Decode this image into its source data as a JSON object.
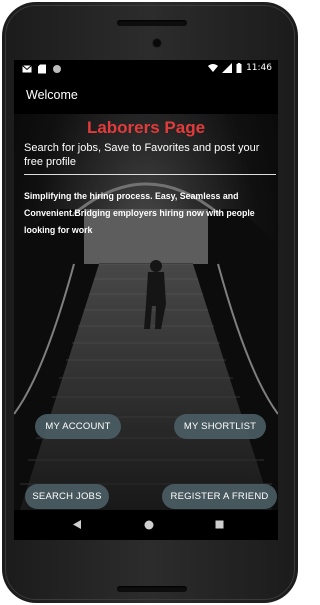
{
  "statusbar": {
    "time": "11:46"
  },
  "appbar": {
    "title": "Welcome"
  },
  "page": {
    "heading": "Laborers Page",
    "subtitle": "Search for jobs, Save to Favorites and post your free profile",
    "description": "Simplifying the hiring process. Easy, Seamless and Convenient.Bridging employers hiring now with people looking for work"
  },
  "buttons": {
    "my_account": "MY ACCOUNT",
    "my_shortlist": "MY SHORTLIST",
    "search_jobs": "SEARCH JOBS",
    "register_friend": "REGISTER A FRIEND"
  },
  "colors": {
    "heading": "#e23b3b",
    "button_bg": "#4b5c64"
  },
  "icons": [
    "mail-icon",
    "sd-card-icon",
    "sync-icon",
    "wifi-icon",
    "signal-icon",
    "battery-icon",
    "back-icon",
    "home-icon",
    "recents-icon"
  ]
}
